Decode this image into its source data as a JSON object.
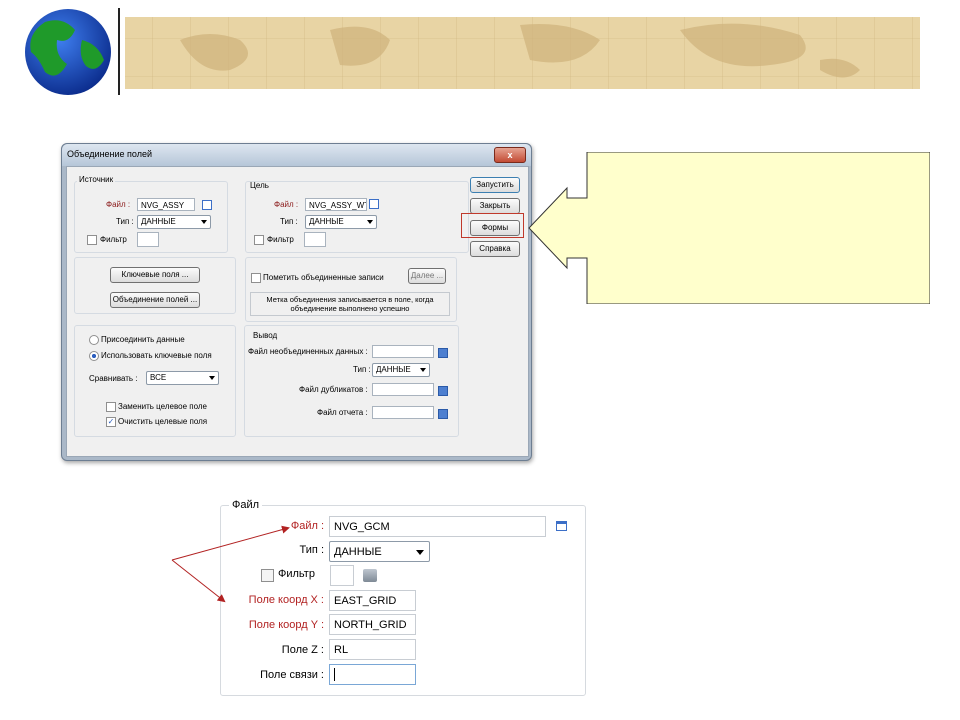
{
  "header": {
    "globe_icon": "globe-icon",
    "map_icon": "world-map-banner"
  },
  "dialog": {
    "title": "Объединение полей",
    "close_label": "x",
    "source": {
      "group_label": "Источник",
      "file_label": "Файл :",
      "file_value": "NVG_ASSY",
      "type_label": "Тип :",
      "type_value": "ДАННЫЕ",
      "filter_label": "Фильтр"
    },
    "target": {
      "group_label": "Цель",
      "file_label": "Файл :",
      "file_value": "NVG_ASSY_WT",
      "type_label": "Тип :",
      "type_value": "ДАННЫЕ",
      "filter_label": "Фильтр"
    },
    "buttons": {
      "run": "Запустить",
      "close": "Закрыть",
      "forms": "Формы",
      "help": "Справка",
      "key_fields": "Ключевые поля ...",
      "merge_fields": "Объединение полей ..."
    },
    "mark": {
      "label": "Пометить объединенные записи",
      "next_button": "Далее ...",
      "info": "Метка объединения записывается в поле, когда объединение выполнено успешно"
    },
    "options": {
      "attach_data": "Присоединить данные",
      "use_key_fields": "Использовать ключевые поля",
      "compare_label": "Сравнивать :",
      "compare_value": "ВСЕ",
      "replace_target": "Заменить целевое поле",
      "clear_target": "Очистить целевые поля"
    },
    "output": {
      "group_label": "Вывод",
      "unmerged_label": "Файл необъединенных данных :",
      "type_label": "Тип :",
      "type_value": "ДАННЫЕ",
      "duplicates_label": "Файл дубликатов :",
      "report_label": "Файл отчета :"
    }
  },
  "file_panel": {
    "group_label": "Файл",
    "file_label": "Файл :",
    "file_value": "NVG_GCM",
    "type_label": "Тип :",
    "type_value": "ДАННЫЕ",
    "filter_label": "Фильтр",
    "coord_x_label": "Поле коорд X :",
    "coord_x_value": "EAST_GRID",
    "coord_y_label": "Поле коорд Y :",
    "coord_y_value": "NORTH_GRID",
    "z_label": "Поле Z :",
    "z_value": "RL",
    "link_label": "Поле связи :",
    "link_value": ""
  },
  "colors": {
    "accent_red": "#b22222",
    "banner": "#e8d4a4",
    "callout_fill": "#ffffcc"
  }
}
